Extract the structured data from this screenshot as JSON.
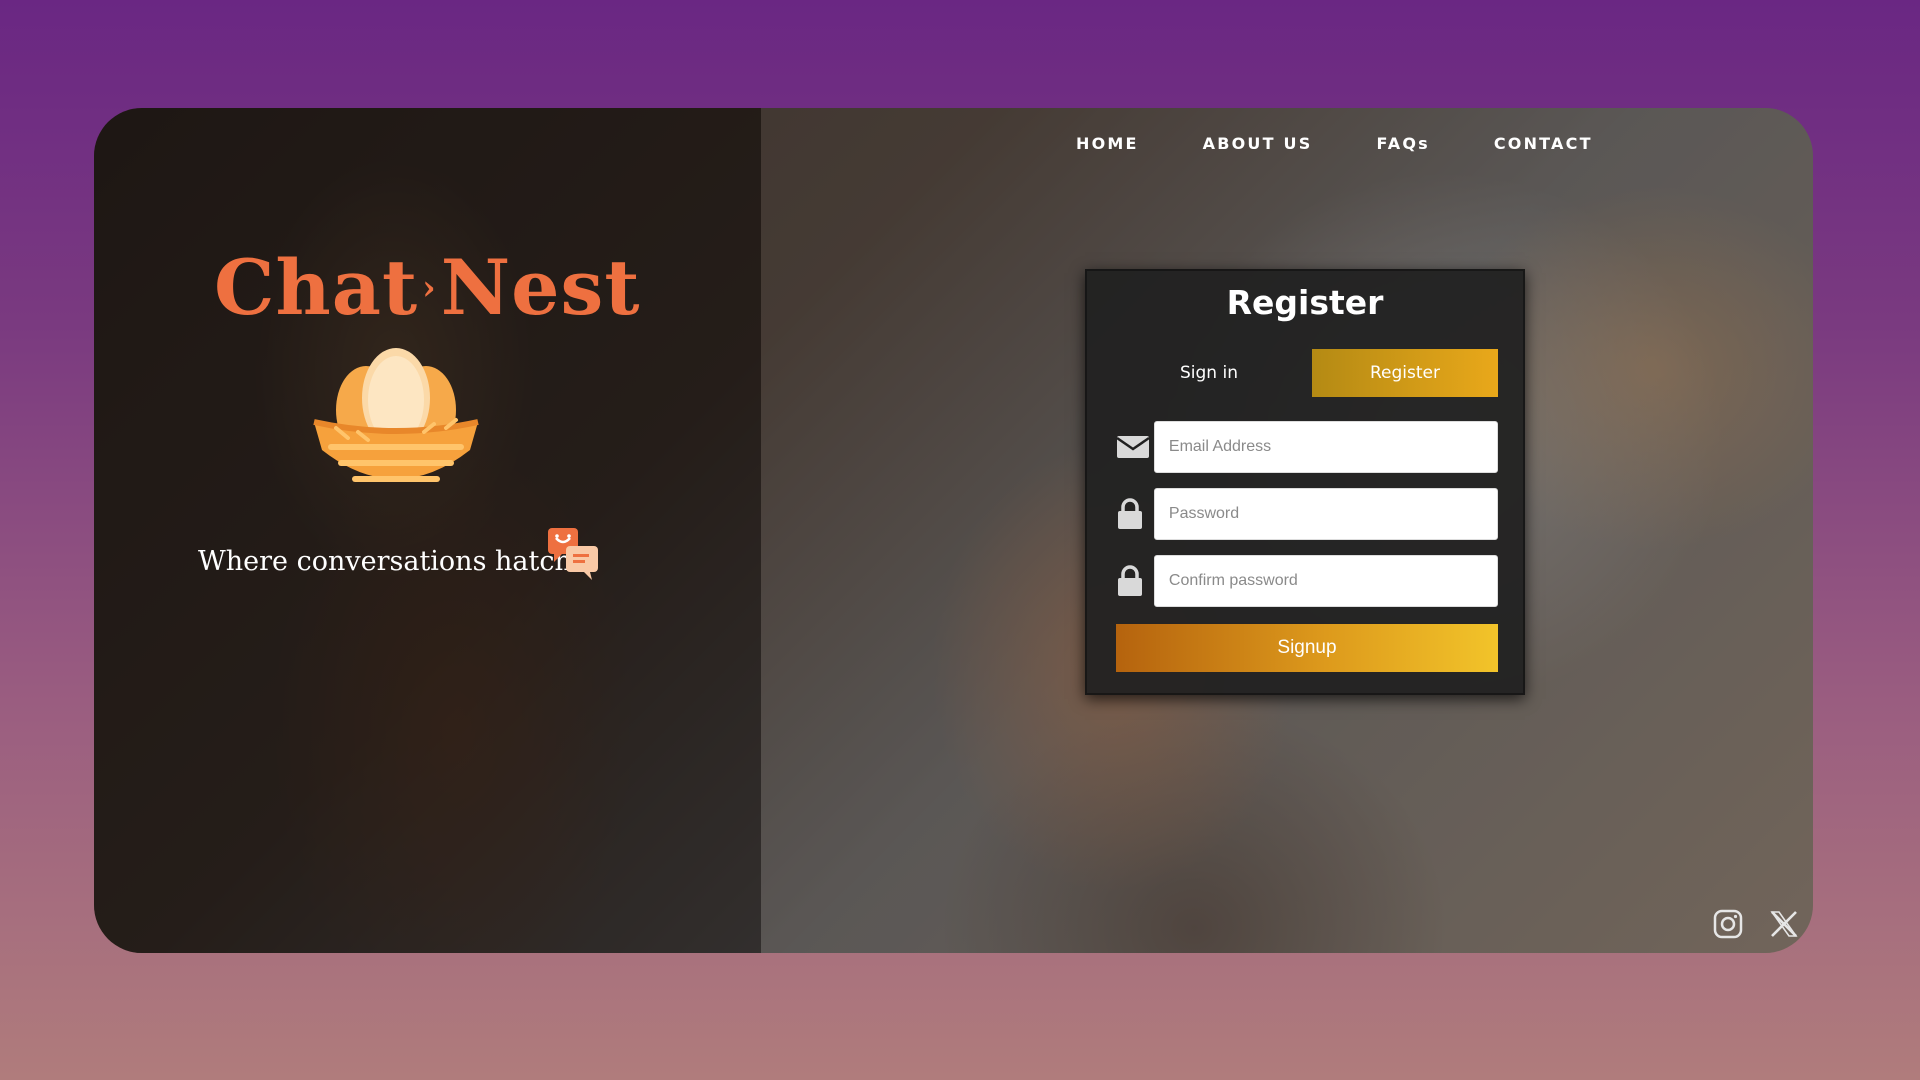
{
  "nav": {
    "items": [
      {
        "label": "HOME"
      },
      {
        "label": "ABOUT US"
      },
      {
        "label": "FAQs"
      },
      {
        "label": "CONTACT"
      }
    ]
  },
  "brand": {
    "name_part1": "Chat",
    "separator": "›",
    "name_part2": "Nest",
    "tagline": "Where conversations hatch.",
    "logo_color": "#ee7040"
  },
  "register": {
    "title": "Register",
    "tab_signin": "Sign in",
    "tab_register": "Register",
    "email_placeholder": "Email Address",
    "password_placeholder": "Password",
    "confirm_placeholder": "Confirm password",
    "signup_label": "Signup",
    "accent": "#e9a81a"
  },
  "social": {
    "icons": [
      "instagram-icon",
      "x-icon"
    ]
  }
}
